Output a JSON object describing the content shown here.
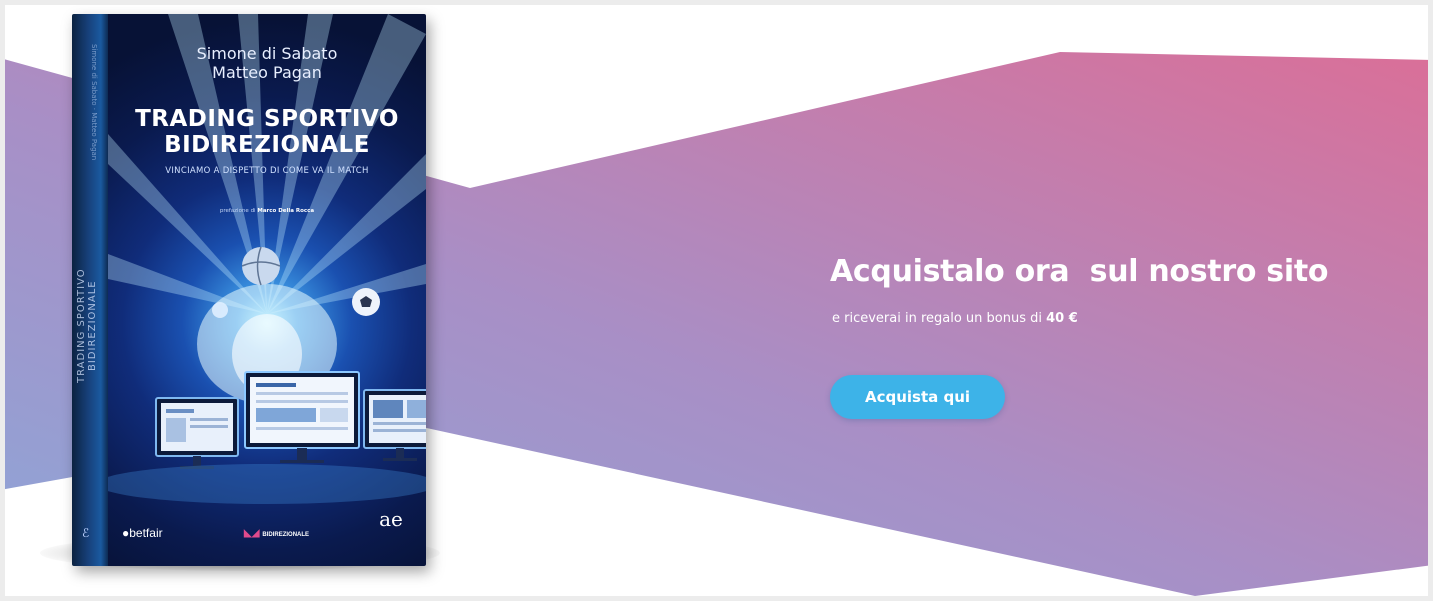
{
  "colors": {
    "band_gradient_start": "#8fa3d4",
    "band_gradient_mid": "#a98bc2",
    "band_gradient_end": "#d5739c",
    "button_background": "#3db3e8",
    "text_on_band": "#ffffff"
  },
  "book": {
    "authors": [
      "Simone di Sabato",
      "Matteo Pagan"
    ],
    "title_lines": [
      "TRADING SPORTIVO",
      "BIDIREZIONALE"
    ],
    "subtitle": "VINCIAMO A DISPETTO DI COME VA IL MATCH",
    "intro_prefix": "prefazione di",
    "intro_name": "Marco Della Rocca",
    "spine_title": "TRADING SPORTIVO BIDIREZIONALE",
    "spine_authors": "Simone di Sabato · Matteo Pagan",
    "logos": {
      "betfair": "betfair",
      "publisher": "BIDIREZIONALE",
      "imprint_mark": "ae"
    },
    "icons": [
      "soccer-ball-icon",
      "basketball-icon",
      "tennis-ball-icon",
      "monitor-icon"
    ]
  },
  "cta": {
    "heading": "Acquistalo ora  sul nostro sito",
    "subtext_prefix": "e riceverai in regalo un bonus di",
    "bonus_amount": "40 €",
    "button_label": "Acquista qui"
  }
}
